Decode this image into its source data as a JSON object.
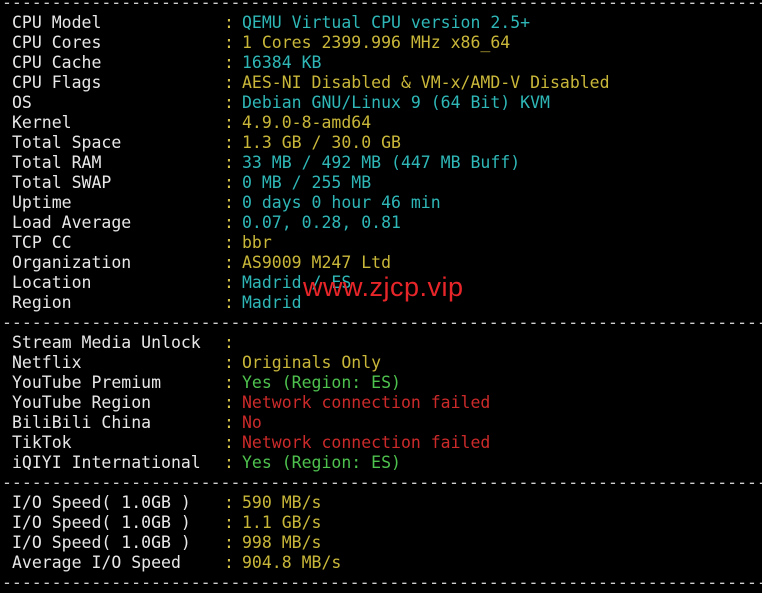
{
  "separator": "---------------------------------------------------------------------------------",
  "system": [
    {
      "key": "CPU Model",
      "value": "QEMU Virtual CPU version 2.5+",
      "color": "cyan"
    },
    {
      "key": "CPU Cores",
      "value": "1 Cores 2399.996 MHz x86_64",
      "color": "yellow"
    },
    {
      "key": "CPU Cache",
      "value": "16384 KB",
      "color": "cyan"
    },
    {
      "key": "CPU Flags",
      "value": "AES-NI Disabled & VM-x/AMD-V Disabled",
      "color": "yellow"
    },
    {
      "key": "OS",
      "value": "Debian GNU/Linux 9 (64 Bit) KVM",
      "color": "cyan"
    },
    {
      "key": "Kernel",
      "value": "4.9.0-8-amd64",
      "color": "yellow"
    },
    {
      "key": "Total Space",
      "value": "1.3 GB / 30.0 GB",
      "color": "yellow"
    },
    {
      "key": "Total RAM",
      "value": "33 MB / 492 MB (447 MB Buff)",
      "color": "cyan"
    },
    {
      "key": "Total SWAP",
      "value": "0 MB / 255 MB",
      "color": "cyan"
    },
    {
      "key": "Uptime",
      "value": "0 days 0 hour 46 min",
      "color": "cyan"
    },
    {
      "key": "Load Average",
      "value": "0.07, 0.28, 0.81",
      "color": "cyan"
    },
    {
      "key": "TCP CC",
      "value": "bbr",
      "color": "yellow"
    },
    {
      "key": "Organization",
      "value": "AS9009 M247 Ltd",
      "color": "yellow"
    },
    {
      "key": "Location",
      "value": "Madrid / ES",
      "color": "cyan"
    },
    {
      "key": "Region",
      "value": "Madrid",
      "color": "cyan"
    }
  ],
  "media": [
    {
      "key": "Stream Media Unlock",
      "value": "",
      "color": "cyan"
    },
    {
      "key": "Netflix",
      "value": "Originals Only",
      "color": "yellow"
    },
    {
      "key": "YouTube Premium",
      "value": "Yes (Region: ES)",
      "color": "green"
    },
    {
      "key": "YouTube Region",
      "value": "Network connection failed",
      "color": "red"
    },
    {
      "key": "BiliBili China",
      "value": "No",
      "color": "red"
    },
    {
      "key": "TikTok",
      "value": "Network connection failed",
      "color": "red"
    },
    {
      "key": "iQIYI International",
      "value": "Yes (Region: ES)",
      "color": "green"
    }
  ],
  "io": [
    {
      "key": "I/O Speed( 1.0GB )",
      "value": "590 MB/s",
      "color": "yellow"
    },
    {
      "key": "I/O Speed( 1.0GB )",
      "value": "1.1 GB/s",
      "color": "yellow"
    },
    {
      "key": "I/O Speed( 1.0GB )",
      "value": "998 MB/s",
      "color": "yellow"
    },
    {
      "key": "Average I/O Speed",
      "value": "904.8 MB/s",
      "color": "yellow"
    }
  ],
  "watermark": "www.zjcp.vip",
  "colors": {
    "cyan": "#2fb7b7",
    "yellow": "#c9b73a",
    "green": "#4ec24e",
    "red": "#cc2a2a",
    "watermark": "#e8262a"
  }
}
